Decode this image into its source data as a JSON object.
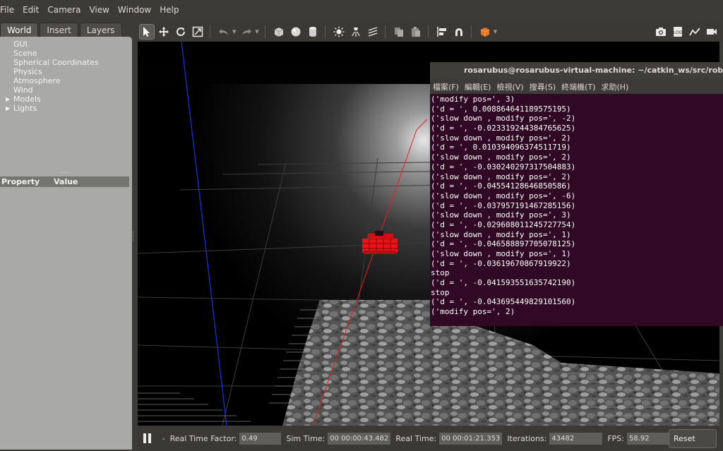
{
  "menubar": {
    "items": [
      "File",
      "Edit",
      "Camera",
      "View",
      "Window",
      "Help"
    ]
  },
  "left_panel": {
    "tabs": [
      {
        "label": "World",
        "active": true
      },
      {
        "label": "Insert",
        "active": false
      },
      {
        "label": "Layers",
        "active": false
      }
    ],
    "tree": [
      {
        "label": "GUI",
        "expandable": false
      },
      {
        "label": "Scene",
        "expandable": false
      },
      {
        "label": "Spherical Coordinates",
        "expandable": false
      },
      {
        "label": "Physics",
        "expandable": false
      },
      {
        "label": "Atmosphere",
        "expandable": false
      },
      {
        "label": "Wind",
        "expandable": false
      },
      {
        "label": "Models",
        "expandable": true
      },
      {
        "label": "Lights",
        "expandable": true
      }
    ],
    "props_header": {
      "property": "Property",
      "value": "Value"
    }
  },
  "toolbar": {
    "tools": [
      "select-icon",
      "translate-icon",
      "rotate-icon",
      "scale-icon",
      "undo-icon",
      "redo-icon",
      "box-icon",
      "sphere-icon",
      "cylinder-icon",
      "point-light-icon",
      "spot-light-icon",
      "directional-light-icon",
      "copy-icon",
      "paste-icon",
      "align-icon",
      "snap-icon",
      "view-angle-icon"
    ],
    "right_tools": [
      "screenshot-icon",
      "log-icon",
      "plot-icon",
      "video-icon"
    ]
  },
  "bottombar": {
    "step": "-",
    "real_time_factor_label": "Real Time Factor:",
    "real_time_factor": "0.49",
    "sim_time_label": "Sim Time:",
    "sim_time": "00 00:00:43.482",
    "real_time_label": "Real Time:",
    "real_time": "00 00:01:21.353",
    "iterations_label": "Iterations:",
    "iterations": "43482",
    "fps_label": "FPS:",
    "fps": "58.92",
    "reset_label": "Reset Time"
  },
  "terminal": {
    "title": "rosarubus@rosarubus-virtual-machine: ~/catkin_ws/src/robotcontrol",
    "menu": [
      "檔案(F)",
      "編輯(E)",
      "檢視(V)",
      "搜尋(S)",
      "終端機(T)",
      "求助(H)"
    ],
    "lines": [
      "('modify pos=', 3)",
      "('d = ', 0.008864641189575195)",
      "('slow down , modify pos=', -2)",
      "('d = ', -0.023319244384765625)",
      "('slow down , modify pos=', 2)",
      "('d = ', 0.010394096374511719)",
      "('slow down , modify pos=', 2)",
      "('d = ', -0.030240297317504883)",
      "('slow down , modify pos=', 2)",
      "('d = ', -0.04554128646850586)",
      "('slow down , modify pos=', -6)",
      "('d = ', -0.037957191467285156)",
      "('slow down , modify pos=', 3)",
      "('d = ', -0.029608011245727754)",
      "('slow down , modify pos=', 1)",
      "('d = ', -0.046588897705078125)",
      "('slow down , modify pos=', 1)",
      "('d = ', -0.03619670867919922)",
      "stop",
      "('d = ', -0.041593551635742190)",
      "stop",
      "('d = ', -0.043695449829101560)",
      "('modify pos=', 2)"
    ]
  },
  "colors": {
    "robot": "#e8141a",
    "x_axis": "#e02020",
    "z_axis": "#1a2fd8",
    "terminal_bg": "#300a24"
  }
}
